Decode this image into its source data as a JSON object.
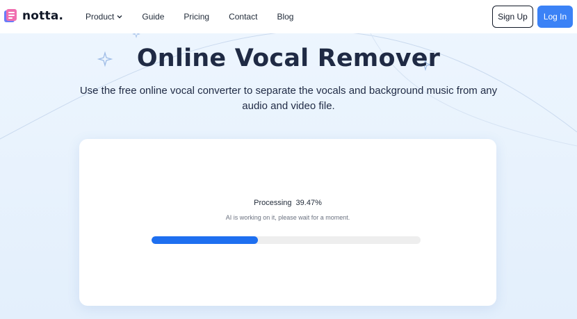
{
  "brand": {
    "name": "notta."
  },
  "nav": {
    "items": [
      {
        "label": "Product",
        "has_dropdown": true
      },
      {
        "label": "Guide"
      },
      {
        "label": "Pricing"
      },
      {
        "label": "Contact"
      },
      {
        "label": "Blog"
      }
    ]
  },
  "auth": {
    "signup_label": "Sign Up",
    "login_label": "Log In"
  },
  "hero": {
    "title": "Online Vocal Remover",
    "subtitle": "Use the free online vocal converter to separate the vocals and background music from any audio and video file."
  },
  "processing": {
    "label": "Processing",
    "percent_text": "39.47%",
    "progress": 0.3947,
    "hint": "AI is working on it, please wait for a moment."
  },
  "colors": {
    "accent": "#3b82f6",
    "progress": "#1e6ff0",
    "title": "#1f2a44"
  },
  "icons": {
    "logo": "notta-logo-icon",
    "dropdown": "chevron-down-icon"
  }
}
